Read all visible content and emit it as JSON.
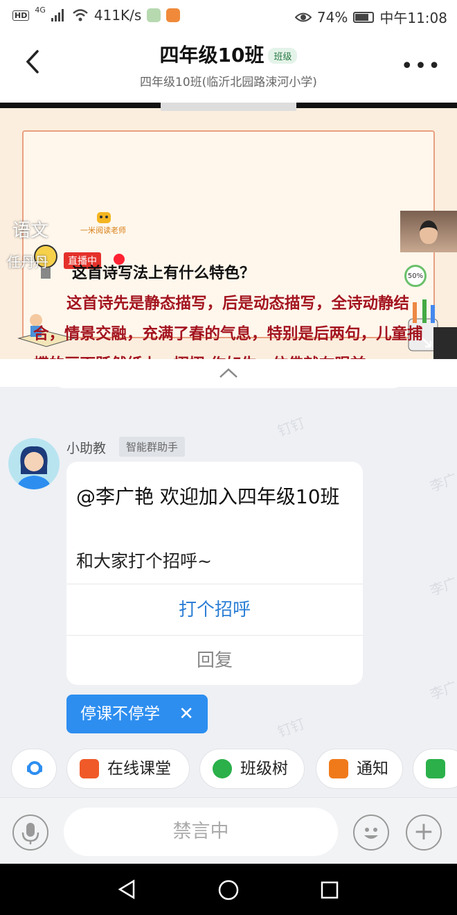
{
  "status_bar": {
    "hd": "HD",
    "network": "4G",
    "speed": "411K/s",
    "battery": "74%",
    "time": "中午11:08"
  },
  "header": {
    "title": "四年级10班",
    "badge": "班级",
    "subtitle": "四年级10班(临沂北园路涑河小学)"
  },
  "video": {
    "subject": "语文",
    "teacher": "任丹丹",
    "brand": "一米阅读老师",
    "live_label": "直播中",
    "question": "这首诗写法上有什么特色？",
    "answer": "这首诗先是静态描写，后是动态描写，全诗动静结合，情景交融，充满了春的气息，特别是后两句，儿童捕蝶的画面跃然纸上，栩栩 作如生，仿佛就在眼前。",
    "progress": "50%"
  },
  "watermark": "钉钉",
  "watermark_name": "李广",
  "message": {
    "sender": "小助教",
    "sender_tag": "智能群助手",
    "greeting": "@李广艳  欢迎加入四年级10班",
    "sub": "和大家打个招呼~",
    "action": "打个招呼",
    "reply": "回复"
  },
  "tip": {
    "label": "停课不停学",
    "close": "✕"
  },
  "shortcuts": [
    {
      "label": "在线课堂",
      "color": "#f05a28"
    },
    {
      "label": "班级树",
      "color": "#2bb04a"
    },
    {
      "label": "通知",
      "color": "#f07a1a"
    }
  ],
  "input": {
    "placeholder": "禁言中"
  }
}
